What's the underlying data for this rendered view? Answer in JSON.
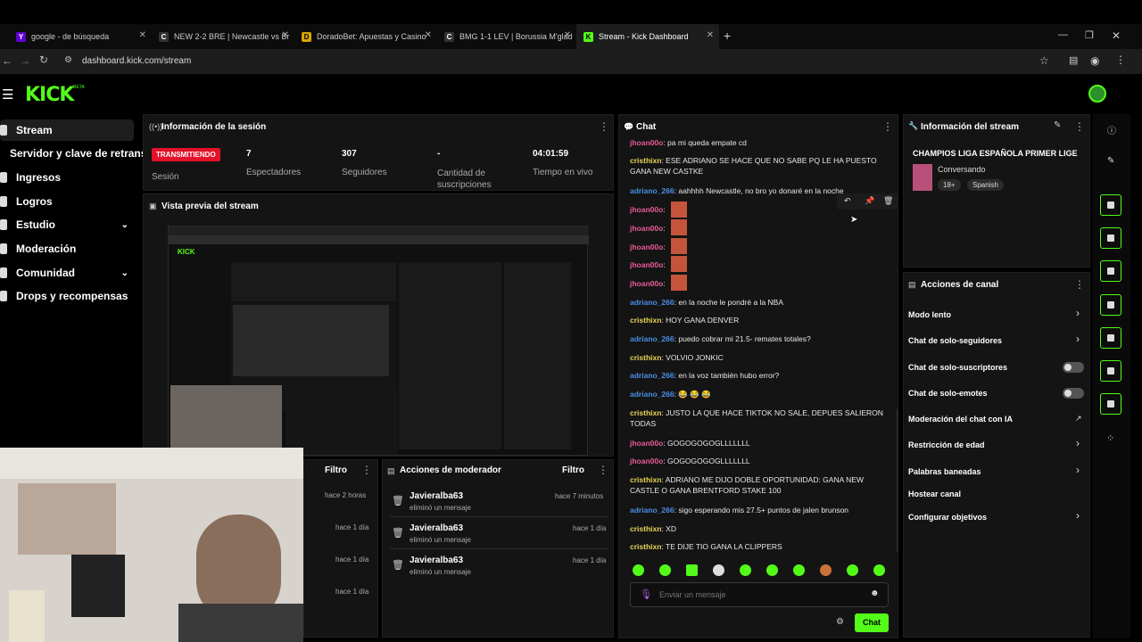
{
  "browser": {
    "tabs": [
      {
        "label": "google - de búsqueda",
        "icon": "yahoo-icon"
      },
      {
        "label": "NEW 2-2 BRE | Newcastle vs Br",
        "icon": "site-icon"
      },
      {
        "label": "DoradoBet: Apuestas y Casino",
        "icon": "site-icon"
      },
      {
        "label": "BMG 1-1 LEV | Borussia M'glad",
        "icon": "site-icon"
      },
      {
        "label": "Stream - Kick Dashboard",
        "icon": "kick-icon"
      }
    ],
    "url": "dashboard.kick.com/stream"
  },
  "header": {
    "logo": "KICK",
    "logo_sup": "BETA"
  },
  "sidebar": {
    "items": [
      {
        "label": "Stream"
      },
      {
        "label": "Servidor y clave de retransm"
      },
      {
        "label": "Ingresos"
      },
      {
        "label": "Logros"
      },
      {
        "label": "Estudio"
      },
      {
        "label": "Moderación"
      },
      {
        "label": "Comunidad"
      },
      {
        "label": "Drops y recompensas"
      }
    ]
  },
  "session": {
    "title": "Información de la sesión",
    "badge": "TRANSMITIENDO",
    "badge_label": "Sesión",
    "stats": [
      {
        "value": "7",
        "label": "Espectadores"
      },
      {
        "value": "307",
        "label": "Seguidores"
      },
      {
        "value": "-",
        "label": "Cantidad de suscripciones"
      },
      {
        "value": "04:01:59",
        "label": "Tiempo en vivo"
      }
    ]
  },
  "preview": {
    "title": "Vista previa del stream"
  },
  "activity": {
    "filter": "Filtro",
    "times": [
      "hace 2 horas",
      "hace 1 día",
      "hace 1 día",
      "hace 1 día"
    ]
  },
  "mod_actions": {
    "title": "Acciones de moderador",
    "filter": "Filtro",
    "items": [
      {
        "user": "Javieralba63",
        "action": "eliminó un mensaje",
        "time": "hace 7 minutos"
      },
      {
        "user": "Javieralba63",
        "action": "eliminó un mensaje",
        "time": "hace 1 día"
      },
      {
        "user": "Javieralba63",
        "action": "eliminó un mensaje",
        "time": "hace 1 día"
      }
    ]
  },
  "chat": {
    "title": "Chat",
    "messages": [
      {
        "user": "jhoan00o",
        "text": "pa mi queda empate cd"
      },
      {
        "user": "cristhixn",
        "text": "ESE ADRIANO SE HACE QUE NO SABE PQ LE HA PUESTO GANA NEW CASTKE"
      },
      {
        "user": "adriano_266",
        "text": "aahhhh Newcastle, no bro yo donaré en la noche"
      },
      {
        "user": "jhoan00o",
        "text": ""
      },
      {
        "user": "jhoan00o",
        "text": ""
      },
      {
        "user": "jhoan00o",
        "text": ""
      },
      {
        "user": "jhoan00o",
        "text": ""
      },
      {
        "user": "jhoan00o",
        "text": ""
      },
      {
        "user": "adriano_266",
        "text": "en la noche le pondré a la NBA"
      },
      {
        "user": "cristhixn",
        "text": "HOY GANA DENVER"
      },
      {
        "user": "adriano_266",
        "text": "puedo cobrar mi 21.5- remates totales?"
      },
      {
        "user": "cristhixn",
        "text": "VOLVIO JONKIC"
      },
      {
        "user": "adriano_266",
        "text": "en la voz también hubo error?"
      },
      {
        "user": "adriano_266",
        "text": "😂 😂 😂"
      },
      {
        "user": "cristhixn",
        "text": "JUSTO LA QUE HACE TIKTOK NO SALE, DEPUES SALIERON TODAS"
      },
      {
        "user": "jhoan00o",
        "text": "GOGOGOGOGLLLLLLL"
      },
      {
        "user": "jhoan00o",
        "text": "GOGOGOGOGLLLLLLL"
      },
      {
        "user": "cristhixn",
        "text": "ADRIANO ME DIJO DOBLE OPORTUNIDAD: GANA NEW CASTLE O GANA BRENTFORD STAKE 100"
      },
      {
        "user": "adriano_266",
        "text": "sigo esperando mis 27.5+ puntos de jalen brunson"
      },
      {
        "user": "cristhixn",
        "text": "XD"
      },
      {
        "user": "cristhixn",
        "text": "TE DIJE TIO GANA LA CLIPPERS"
      }
    ],
    "input_placeholder": "Enviar un mensaje",
    "send": "Chat"
  },
  "stream_info": {
    "title": "Información del stream",
    "stream_title": "CHAMPIOS LIGA ESPAÑOLA PRIMER LIGE",
    "category": "Conversando",
    "tags": [
      "18+",
      "Spanish"
    ]
  },
  "channel_actions": {
    "title": "Acciones de canal",
    "items": [
      {
        "label": "Modo lento",
        "control": "chevron"
      },
      {
        "label": "Chat de solo-seguidores",
        "control": "chevron"
      },
      {
        "label": "Chat de solo-suscriptores",
        "control": "toggle"
      },
      {
        "label": "Chat de solo-emotes",
        "control": "toggle"
      },
      {
        "label": "Moderación del chat con IA",
        "control": "external"
      },
      {
        "label": "Restricción de edad",
        "control": "chevron"
      },
      {
        "label": "Palabras baneadas",
        "control": "chevron"
      },
      {
        "label": "Hostear canal",
        "control": "none"
      },
      {
        "label": "Configurar objetivos",
        "control": "chevron"
      }
    ]
  },
  "colors": {
    "accent": "#53fc18",
    "live": "#e3112a",
    "panel": "#141414"
  }
}
